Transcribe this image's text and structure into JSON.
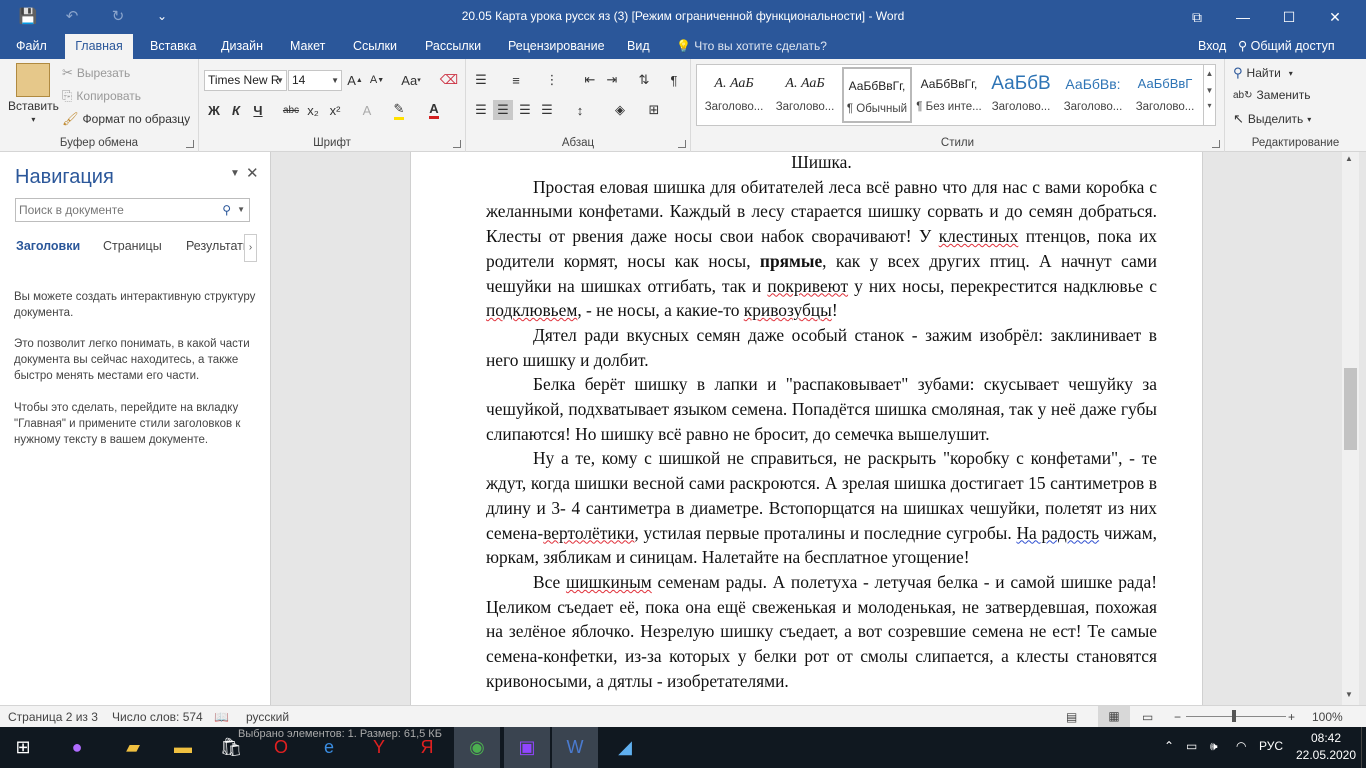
{
  "titlebar": {
    "title": "20.05 Карта урока русск яз  (3) [Режим ограниченной функциональности] - Word",
    "save_icon": "💾",
    "undo_icon": "↶",
    "redo_icon": "↻",
    "customize_icon": "⌄",
    "ribbon_opts_icon": "⧉",
    "minimize_icon": "—",
    "maximize_icon": "☐",
    "close_icon": "✕"
  },
  "tabs": {
    "items": [
      "Файл",
      "Главная",
      "Вставка",
      "Дизайн",
      "Макет",
      "Ссылки",
      "Рассылки",
      "Рецензирование",
      "Вид"
    ],
    "active": "Главная",
    "tell_me": "Что вы хотите сделать?",
    "sign_in": "Вход",
    "share": "Общий доступ"
  },
  "ribbon": {
    "clipboard": {
      "label": "Буфер обмена",
      "paste": "Вставить",
      "cut": "Вырезать",
      "copy": "Копировать",
      "format_painter": "Формат по образцу"
    },
    "font": {
      "label": "Шрифт",
      "font_name": "Times New R",
      "font_size": "14",
      "bold": "Ж",
      "italic": "К",
      "underline": "Ч",
      "strike": "abc",
      "sub": "x₂",
      "sup": "x²",
      "grow": "A^",
      "shrink": "Aˇ",
      "case": "Aa",
      "clear": "A"
    },
    "paragraph": {
      "label": "Абзац"
    },
    "styles": {
      "label": "Стили",
      "items": [
        {
          "preview": "А.  АаБ",
          "name": "Заголово..."
        },
        {
          "preview": "А.  АаБ",
          "name": "Заголово..."
        },
        {
          "preview": "АаБбВвГг,",
          "name": "¶ Обычный"
        },
        {
          "preview": "АаБбВвГг,",
          "name": "¶ Без инте..."
        },
        {
          "preview": "АаБбВ",
          "name": "Заголово..."
        },
        {
          "preview": "АаБбВв:",
          "name": "Заголово..."
        },
        {
          "preview": "АаБбВвГ",
          "name": "Заголово..."
        }
      ],
      "selected_index": 2
    },
    "editing": {
      "label": "Редактирование",
      "find": "Найти",
      "replace": "Заменить",
      "select": "Выделить"
    }
  },
  "nav": {
    "title": "Навигация",
    "search_placeholder": "Поиск в документе",
    "tabs": [
      "Заголовки",
      "Страницы",
      "Результаты"
    ],
    "active_tab": "Заголовки",
    "help": [
      "Вы можете создать интерактивную структуру документа.",
      "Это позволит легко понимать, в какой части документа вы сейчас находитесь, а также быстро менять местами его части.",
      "Чтобы это сделать, перейдите на вкладку \"Главная\" и примените стили заголовков к нужному тексту в вашем документе."
    ]
  },
  "document": {
    "title": "Шишка.",
    "p1": {
      "a": "Простая еловая шишка для обитателей леса всё равно что для нас с вами коробка с желанными конфетами. Каждый в лесу старается шишку сорвать и до семян добраться. Клесты от рвения даже носы свои набок сворачивают! У ",
      "w1": "клестиных",
      "b": " птенцов, пока их родители кормят, носы как носы, ",
      "bold": "прямые",
      "c": ", как у всех других птиц. А начнут сами чешуйки на шишках отгибать, так и ",
      "w2": "покривеют",
      "d": " у них носы, перекрестится надклювье с ",
      "w3": "подклювьем",
      "e": ", - не носы, а какие-то ",
      "w4": "кривозубцы",
      "f": "!"
    },
    "p2": "Дятел ради вкусных семян даже особый станок - зажим изобрёл: заклинивает в него шишку и долбит.",
    "p3": "Белка берёт шишку в лапки и \"распаковывает\" зубами: скусывает чешуйку за чешуйкой, подхватывает языком семена. Попадётся шишка смоляная, так у неё даже губы слипаются! Но шишку всё равно не бросит, до семечка вышелушит.",
    "p4": {
      "a": "Ну а те, кому с шишкой не справиться, не раскрыть \"коробку с конфетами\", - те ждут, когда шишки весной сами раскроются. А зрелая шишка достигает 15 сантиметров в длину и 3- 4 сантиметра в диаметре. Встопорщатся на шишках чешуйки, полетят из них семена-",
      "w1": "вертолётики",
      "b": ", устилая первые проталины и последние сугробы. ",
      "w2": "На радость",
      "c": " чижам, юркам, зябликам и синицам. Налетайте на бесплатное угощение!"
    },
    "p5": {
      "a": "Все ",
      "w1": "шишкиным",
      "b": " семенам рады. А полетуха - летучая белка - и самой шишке рада! Целиком съедает её, пока она ещё свеженькая и молоденькая, не затвердевшая, похожая на зелёное яблочко. Незрелую шишку съедает, а вот созревшие семена не ест! Те самые семена-конфетки, из-за которых у белки рот от смолы слипается, а клесты становятся кривоносыми, а дятлы - изобретателями."
    }
  },
  "status": {
    "page": "Страница 2 из 3",
    "words": "Число слов: 574",
    "language": "русский",
    "zoom": "100%"
  },
  "taskbar": {
    "overlay_text": "Выбрано элементов: 1. Размер: 61,5 КБ",
    "lang": "РУС",
    "time": "08:42",
    "date": "22.05.2020"
  }
}
